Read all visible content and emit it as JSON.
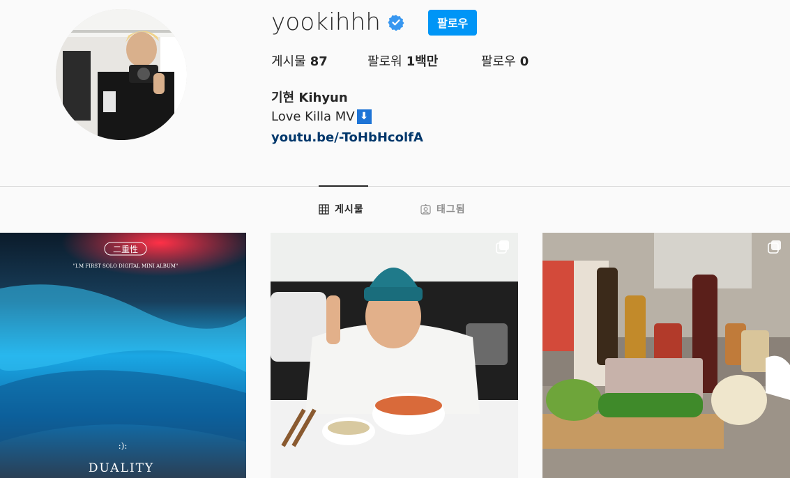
{
  "profile": {
    "username": "yookihhh",
    "verified": true,
    "follow_label": "팔로우",
    "stats": {
      "posts_label": "게시물",
      "posts_value": "87",
      "followers_label": "팔로워",
      "followers_value": "1백만",
      "following_label": "팔로우",
      "following_value": "0"
    },
    "full_name": "기현 Kihyun",
    "bio": "Love Killa MV",
    "bio_emoji": "⬇",
    "link": "youtu.be/-ToHbHcolfA"
  },
  "tabs": [
    {
      "label": "게시물",
      "icon": "grid-icon",
      "active": true
    },
    {
      "label": "태그됨",
      "icon": "tagged-icon",
      "active": false
    }
  ],
  "posts": [
    {
      "name": "duality-album-cover",
      "multiple": false,
      "cover_title": "DUALITY",
      "cover_hanja": "二重性",
      "cover_caption": "\"I.M FIRST SOLO DIGITAL MINI ALBUM\"",
      "cover_symbol": ":):"
    },
    {
      "name": "peace-sign-selfie",
      "multiple": true
    },
    {
      "name": "cooking-ingredients",
      "multiple": true
    }
  ],
  "colors": {
    "accent": "#0095f6",
    "link": "#00376b",
    "verified": "#3897f0"
  }
}
